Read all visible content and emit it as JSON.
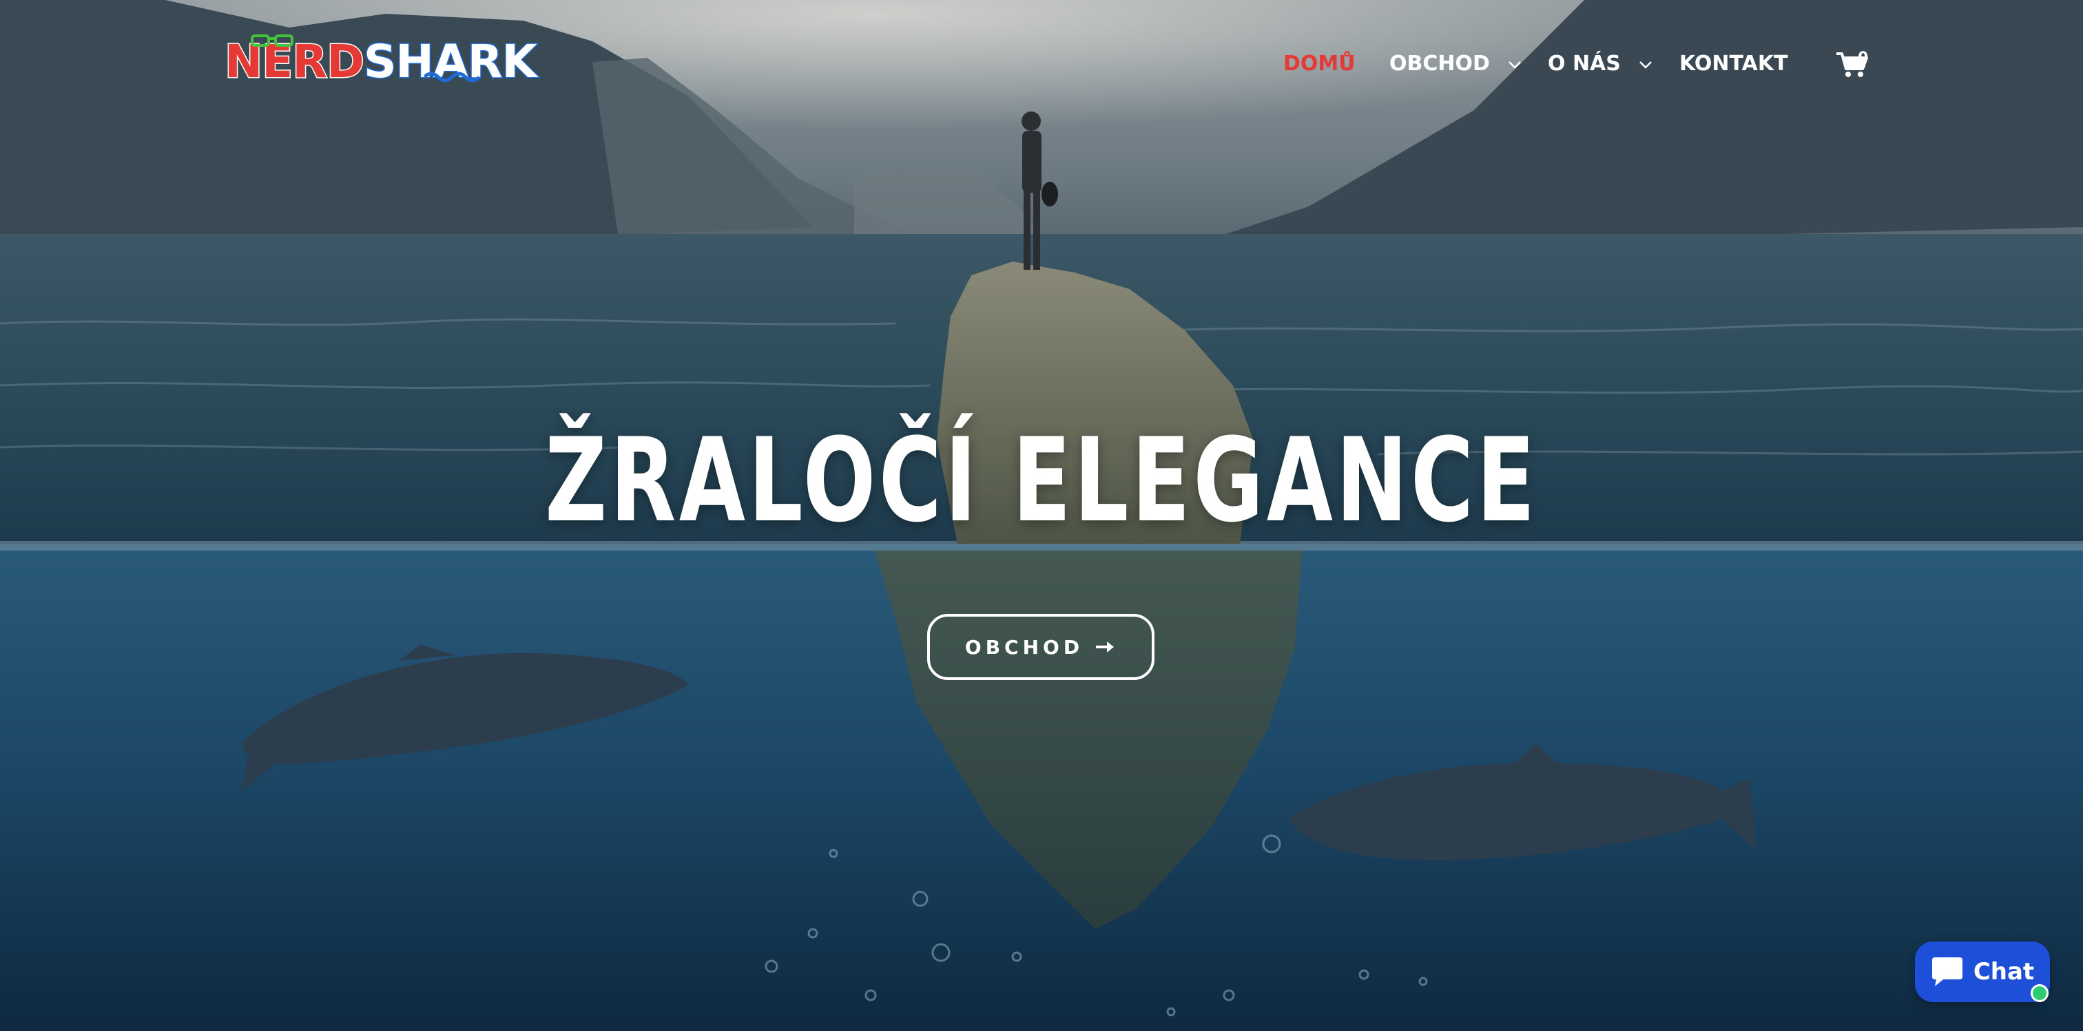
{
  "brand": {
    "logo_part1": "NERD",
    "logo_part2": "SHARK",
    "colors": {
      "red": "#e53935",
      "blue": "#1e6ad6",
      "nav_active": "#e53935",
      "chat": "#1e4fd8"
    }
  },
  "nav": {
    "items": [
      {
        "label": "DOMŮ",
        "active": true
      },
      {
        "label": "OBCHOD",
        "dropdown": true
      },
      {
        "label": "O NÁS",
        "dropdown": true
      },
      {
        "label": "KONTAKT"
      }
    ],
    "cart_icon": "cart-icon",
    "cart_count": "0"
  },
  "hero": {
    "headline": "ŽRALOČÍ ELEGANCE",
    "cta_label": "OBCHOD",
    "cta_icon": "arrow-right-icon"
  },
  "chat": {
    "label": "Chat",
    "icon": "chat-bubble-icon",
    "status": "online"
  }
}
